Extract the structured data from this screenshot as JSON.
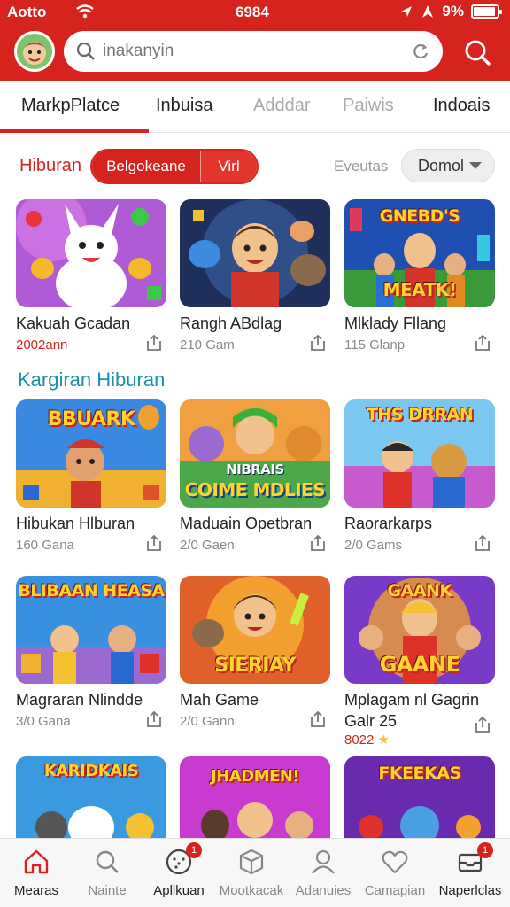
{
  "status": {
    "carrier": "Aotto",
    "time": "6984",
    "battery": "9%"
  },
  "search": {
    "placeholder": "inakanyin"
  },
  "tabs": [
    "MarkpPlatce",
    "Inbuisa",
    "Adddar",
    "Paiwis",
    "Indoais"
  ],
  "filter": {
    "label": "Hiburan",
    "segment_on": "Belgokeane",
    "segment_off": "Virl",
    "events_label": "Eveutas",
    "dropdown_value": "Domol"
  },
  "section_title": "Kargiran Hiburan",
  "cards": [
    {
      "title": "Kakuah Gcadan",
      "meta": "2002ann",
      "overlay": ""
    },
    {
      "title": "Rangh ABdlag",
      "meta": "210 Gam",
      "overlay": ""
    },
    {
      "title": "Mlklady Fllang",
      "meta": "115 Glanp",
      "overlay": "GNEBD'S MEATK!"
    },
    {
      "title": "Hibukan Hlburan",
      "meta": "160 Gana",
      "overlay": "BBUARK"
    },
    {
      "title": "Maduain Opetbran",
      "meta": "2/0 Gaen",
      "overlay": "COIME MDLIES"
    },
    {
      "title": "Raorarkarps",
      "meta": "2/0 Gams",
      "overlay": "THS DRRAN"
    },
    {
      "title": "Magraran Nlindde",
      "meta": "3/0 Gana",
      "overlay": "BLIBAAN HEASA"
    },
    {
      "title": "Mah Game",
      "meta": "2/0 Gann",
      "overlay": "SIERIAY"
    },
    {
      "title": "Mplagam nl Gagrin",
      "meta": "8022",
      "title_line2": "Galr 25",
      "overlay": "GAANE"
    },
    {
      "title": "",
      "meta": "",
      "overlay": "KARIDKAIS"
    },
    {
      "title": "",
      "meta": "",
      "overlay": "JHADMEN!"
    },
    {
      "title": "",
      "meta": "",
      "overlay": "FKEEKAS"
    }
  ],
  "bottom_nav": [
    {
      "label": "Mearas",
      "icon": "home-icon",
      "badge": ""
    },
    {
      "label": "Nainte",
      "icon": "search-icon",
      "badge": ""
    },
    {
      "label": "Apllkuan",
      "icon": "apps-icon",
      "badge": "1"
    },
    {
      "label": "Mootkacak",
      "icon": "box-icon",
      "badge": ""
    },
    {
      "label": "Adanuies",
      "icon": "person-icon",
      "badge": ""
    },
    {
      "label": "Camapian",
      "icon": "heart-icon",
      "badge": ""
    },
    {
      "label": "Naperlclas",
      "icon": "inbox-icon",
      "badge": "1"
    }
  ],
  "colors": {
    "accent": "#d6231e",
    "section": "#1a8fb0"
  }
}
